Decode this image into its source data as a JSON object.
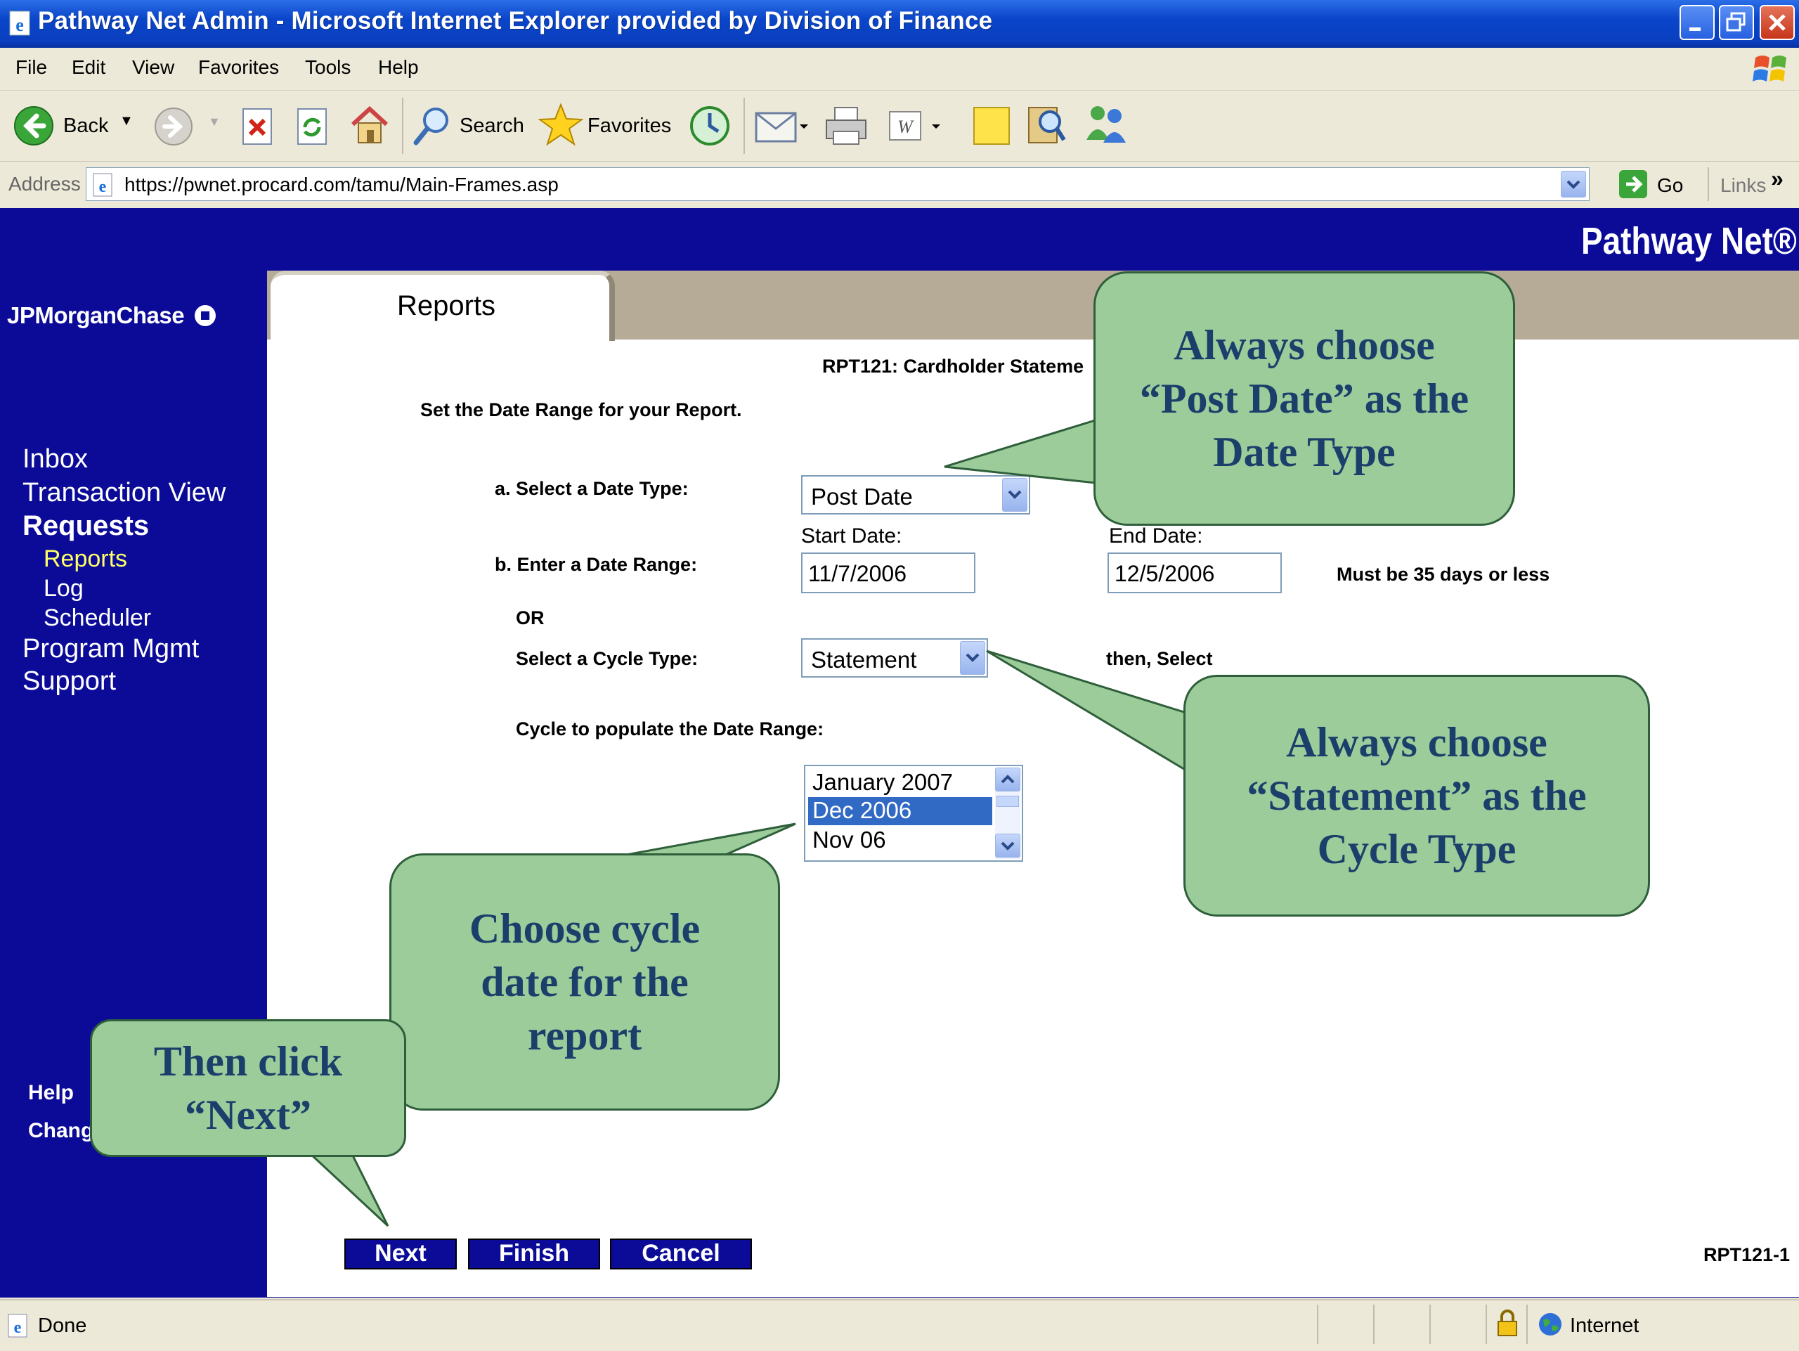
{
  "window": {
    "title": "Pathway Net Admin - Microsoft Internet Explorer provided by Division of Finance"
  },
  "menu": [
    "File",
    "Edit",
    "View",
    "Favorites",
    "Tools",
    "Help"
  ],
  "toolbar": {
    "back_label": "Back",
    "search_label": "Search",
    "favorites_label": "Favorites"
  },
  "address": {
    "label": "Address",
    "url": "https://pwnet.procard.com/tamu/Main-Frames.asp",
    "go_label": "Go",
    "links_label": "Links"
  },
  "brand": {
    "product": "Pathway Net®",
    "bank": "JPMorganChase"
  },
  "sidebar": {
    "items": [
      {
        "label": "Inbox"
      },
      {
        "label": "Transaction View"
      },
      {
        "label": "Requests"
      },
      {
        "label": "Reports"
      },
      {
        "label": "Log"
      },
      {
        "label": "Scheduler"
      },
      {
        "label": "Program Mgmt"
      },
      {
        "label": "Support"
      }
    ],
    "help": "Help",
    "change": "Chang"
  },
  "tab": {
    "label": "Reports"
  },
  "report": {
    "title": "RPT121: Cardholder Stateme",
    "instruction": "Set the Date Range for your Report.",
    "date_type_label": "a.  Select a Date Type:",
    "date_type_value": "Post Date",
    "date_range_label": "b.  Enter a Date Range:",
    "start_label": "Start Date:",
    "start_value": "11/7/2006",
    "end_label": "End Date:",
    "end_value": "12/5/2006",
    "range_note": "Must be 35 days or less",
    "or_label": "OR",
    "cycle_type_label": "Select a Cycle Type:",
    "cycle_type_value": "Statement",
    "then_select": "then, Select",
    "cycle_populate_label": "Cycle to populate the Date Range:",
    "cycle_options": [
      "January 2007",
      "Dec 2006",
      "Nov 06"
    ],
    "cycle_selected": "Dec 2006",
    "buttons": {
      "next": "Next",
      "finish": "Finish",
      "cancel": "Cancel"
    },
    "code": "RPT121-1"
  },
  "callouts": {
    "date_type": [
      "Always choose",
      "“Post Date” as the",
      "Date Type"
    ],
    "cycle_type": [
      "Always choose",
      "“Statement” as the",
      "Cycle Type"
    ],
    "cycle_date": [
      "Choose cycle",
      "date for the",
      "report"
    ],
    "next": [
      "Then click",
      "“Next”"
    ]
  },
  "status": {
    "left": "Done",
    "zone": "Internet"
  },
  "colors": {
    "titlebar": "#0a45c9",
    "app_background": "#0b0b98",
    "sidebar_active": "#ffff66",
    "callout_fill": "#9dcc9b",
    "callout_text": "#1b3f6b",
    "selection": "#316ac5"
  },
  "icons": [
    "ie-page-icon",
    "minimize-icon",
    "maximize-icon",
    "close-icon",
    "windows-flag-icon",
    "back-arrow-icon",
    "forward-arrow-icon",
    "stop-icon",
    "refresh-icon",
    "home-icon",
    "search-icon",
    "favorites-star-icon",
    "history-icon",
    "mail-icon",
    "print-icon",
    "edit-word-icon",
    "notes-icon",
    "research-icon",
    "messenger-icon",
    "go-arrow-icon",
    "lock-icon",
    "globe-icon"
  ]
}
